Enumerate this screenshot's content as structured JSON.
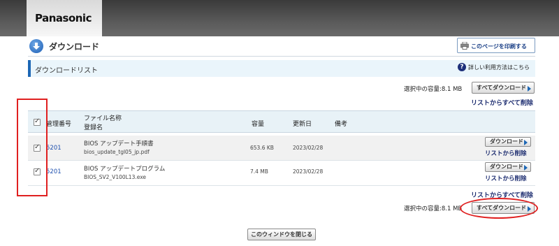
{
  "header": {
    "logo": "Panasonic"
  },
  "page": {
    "title": "ダウンロード",
    "print_button": "このページを印刷する"
  },
  "section": {
    "title": "ダウンロードリスト",
    "help_link": "詳しい利用方法はこちら"
  },
  "summary_top": {
    "capacity_label": "選択中の容量:8.1 MB",
    "download_all": "すべてダウンロード",
    "remove_all": "リストからすべて削除"
  },
  "table": {
    "columns": {
      "id": "管理番号",
      "name_line1": "ファイル名称",
      "name_line2": "登録名",
      "size": "容量",
      "date": "更新日",
      "note": "備考"
    },
    "rows": [
      {
        "id": "5201",
        "name": "BIOS アップデート手順書",
        "file": "bios_update_tgl05_jp.pdf",
        "size": "653.6 KB",
        "date": "2023/02/28",
        "download": "ダウンロード",
        "remove": "リストから削除",
        "checked": true
      },
      {
        "id": "5201",
        "name": "BIOS アップデートプログラム",
        "file": "BIOS_SV2_V100L13.exe",
        "size": "7.4 MB",
        "date": "2023/02/28",
        "download": "ダウンロード",
        "remove": "リストから削除",
        "checked": true
      }
    ]
  },
  "summary_bottom": {
    "remove_all": "リストからすべて削除",
    "capacity_label": "選択中の容量:8.1 MB",
    "download_all": "すべてダウンロード"
  },
  "close_button": "このウィンドウを閉じる",
  "colors": {
    "accent": "#1d67b5",
    "highlight": "#e02020",
    "link": "#1a2a6e"
  }
}
